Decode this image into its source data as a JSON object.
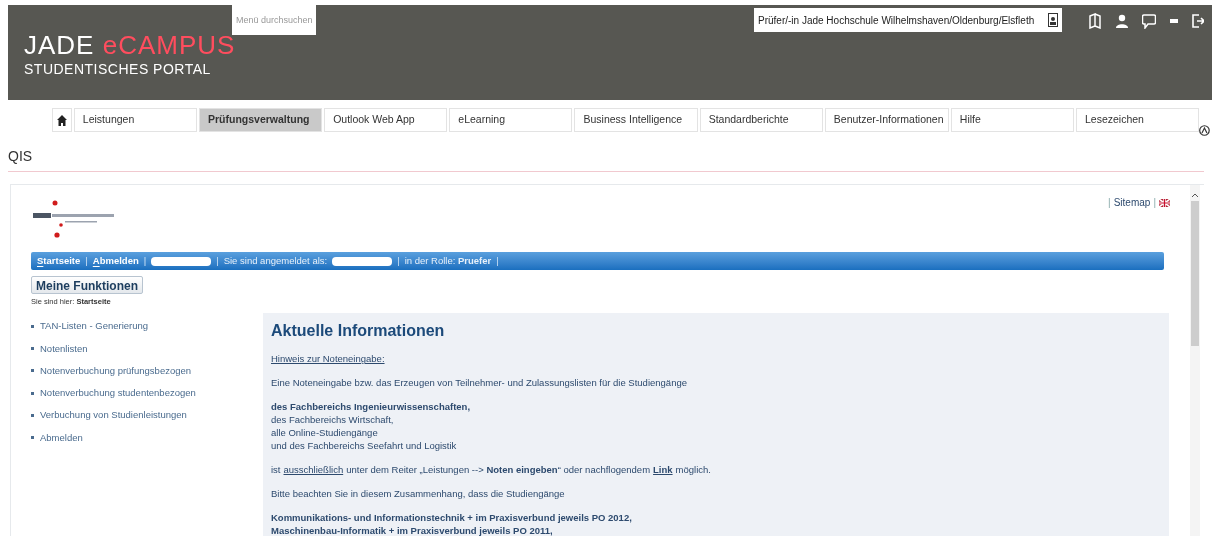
{
  "header": {
    "logo_primary": "JADE",
    "logo_accent": "eCAMPUS",
    "logo_subtitle": "STUDENTISCHES PORTAL",
    "menu_search": {
      "placeholder": "Menü durchsuchen"
    },
    "role_field": {
      "value": "Prüfer/-in Jade Hochschule Wilhelmshaven/Oldenburg/Elsfleth"
    }
  },
  "nav": [
    {
      "label": "Leistungen",
      "selected": false
    },
    {
      "label": "Prüfungsverwaltung",
      "selected": true
    },
    {
      "label": "Outlook Web App",
      "selected": false
    },
    {
      "label": "eLearning",
      "selected": false
    },
    {
      "label": "Business Intelligence",
      "selected": false
    },
    {
      "label": "Standardberichte",
      "selected": false
    },
    {
      "label": "Benutzer-Informationen",
      "selected": false
    },
    {
      "label": "Hilfe",
      "selected": false
    },
    {
      "label": "Lesezeichen",
      "selected": false
    }
  ],
  "page_title": "QIS",
  "qis": {
    "top_links": [
      {
        "kind": "separator",
        "text": "|"
      },
      {
        "kind": "link",
        "text": "Sitemap"
      },
      {
        "kind": "separator",
        "text": "|"
      }
    ],
    "bar": [
      {
        "kind": "link",
        "text": "Startseite"
      },
      {
        "kind": "separator",
        "text": "|"
      },
      {
        "kind": "link",
        "text": "Abmelden"
      },
      {
        "kind": "separator",
        "text": "|"
      },
      {
        "kind": "redacted"
      },
      {
        "kind": "separator",
        "text": "|"
      },
      {
        "kind": "text",
        "text": "Sie sind angemeldet als:"
      },
      {
        "kind": "redacted"
      },
      {
        "kind": "separator",
        "text": "|"
      },
      {
        "kind": "text",
        "text": "in der Rolle: **Pruefer**"
      },
      {
        "kind": "separator",
        "text": "|"
      }
    ],
    "functions_button": "Meine Funktionen",
    "breadcrumb": "Sie sind hier: **Startseite**",
    "menu": [
      "TAN-Listen - Generierung",
      "Notenlisten",
      "Notenverbuchung prüfungsbezogen",
      "Notenverbuchung studentenbezogen",
      "Verbuchung von Studienleistungen",
      "Abmelden"
    ],
    "info": {
      "title": "Aktuelle Informationen",
      "blocks": [
        {
          "kind": "link",
          "lines": [
            "Hinweis zur Noteneingabe:"
          ]
        },
        {
          "kind": "text",
          "lines": [
            "Eine Noteneingabe bzw. das Erzeugen von Teilnehmer- und Zulassungslisten für die Studiengänge"
          ]
        },
        {
          "kind": "text",
          "lines": [
            "**des Fachbereichs Ingenieurwissenschaften,**",
            "des Fachbereichs Wirtschaft,",
            "alle Online-Studiengänge",
            "und des Fachbereichs Seefahrt und Logistik"
          ]
        },
        {
          "kind": "mixed",
          "parts": [
            {
              "kind": "text",
              "text": "ist"
            },
            {
              "kind": "link",
              "text": "ausschließlich",
              "bold": false
            },
            {
              "kind": "text",
              "text": "unter dem Reiter „Leistungen --> **Noten eingeben**“ oder nachflogendem"
            },
            {
              "kind": "link",
              "text": "Link",
              "bold": true
            },
            {
              "kind": "text",
              "text": "möglich."
            }
          ]
        },
        {
          "kind": "text",
          "lines": [
            "Bitte beachten Sie in diesem Zusammenhang, dass die Studiengänge"
          ]
        },
        {
          "kind": "text",
          "lines": [
            "**Kommunikations- und Informationstechnik + im Praxisverbund jeweils PO 2012,**",
            "**Maschinenbau-Informatik + im Praxisverbund jeweils PO 2011,**"
          ]
        }
      ]
    }
  }
}
